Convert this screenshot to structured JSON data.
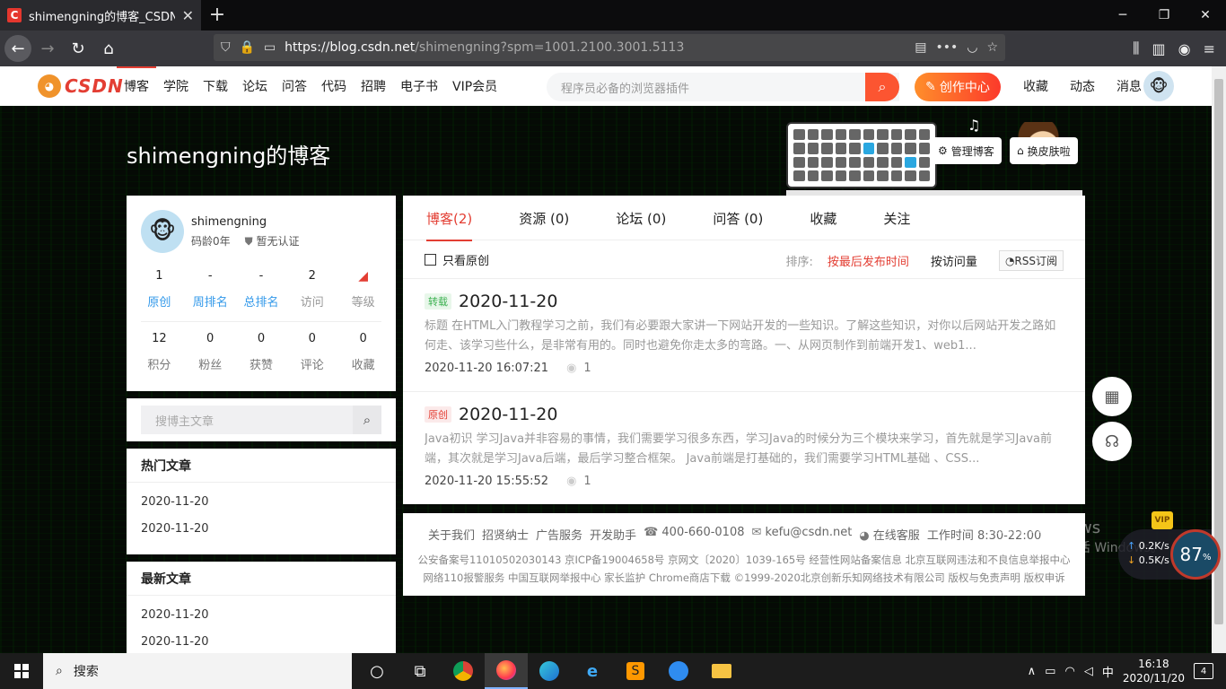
{
  "browser": {
    "tab_title": "shimengning的博客_CSDN博",
    "favicon": "C",
    "url_host": "https://blog.csdn.net",
    "url_path": "/shimengning?spm=1001.2100.3001.5113"
  },
  "header": {
    "logo_text": "CSDN",
    "nav": [
      "博客",
      "学院",
      "下载",
      "论坛",
      "问答",
      "代码",
      "招聘",
      "电子书",
      "VIP会员"
    ],
    "search_placeholder": "程序员必备的浏览器插件",
    "create_label": "创作中心",
    "links": [
      "收藏",
      "动态",
      "消息"
    ]
  },
  "banner": {
    "blog_title": "shimengning的博客",
    "manage_label": "管理博客",
    "skin_label": "换皮肤啦"
  },
  "profile": {
    "username": "shimengning",
    "age": "码龄0年",
    "cert": "暂无认证",
    "stats1": [
      {
        "num": "1",
        "label": "原创"
      },
      {
        "num": "-",
        "label": "周排名"
      },
      {
        "num": "-",
        "label": "总排名"
      },
      {
        "num": "2",
        "label": "访问"
      },
      {
        "num": "",
        "label": "等级"
      }
    ],
    "stats2": [
      {
        "num": "12",
        "label": "积分"
      },
      {
        "num": "0",
        "label": "粉丝"
      },
      {
        "num": "0",
        "label": "获赞"
      },
      {
        "num": "0",
        "label": "评论"
      },
      {
        "num": "0",
        "label": "收藏"
      }
    ]
  },
  "sidebar_search": {
    "placeholder": "搜博主文章"
  },
  "hot": {
    "title": "热门文章",
    "items": [
      "2020-11-20",
      "2020-11-20"
    ]
  },
  "latest": {
    "title": "最新文章",
    "items": [
      "2020-11-20",
      "2020-11-20"
    ]
  },
  "tabs": [
    "博客(2)",
    "资源 (0)",
    "论坛 (0)",
    "问答 (0)",
    "收藏",
    "关注"
  ],
  "filter": {
    "original_only": "只看原创",
    "sort_label": "排序:",
    "sort_options": [
      "按最后发布时间",
      "按访问量"
    ],
    "rss": "RSS订阅"
  },
  "articles": [
    {
      "tag": "转载",
      "title": "2020-11-20",
      "desc": "标题 在HTML入门教程学习之前，我们有必要跟大家讲一下网站开发的一些知识。了解这些知识，对你以后网站开发之路如何走、该学习些什么，是非常有用的。同时也避免你走太多的弯路。一、从网页制作到前端开发1、web1...",
      "time": "2020-11-20 16:07:21",
      "views": "1"
    },
    {
      "tag": "原创",
      "title": "2020-11-20",
      "desc": "Java初识 学习Java并非容易的事情，我们需要学习很多东西，学习Java的时候分为三个模块来学习，首先就是学习Java前端，其次就是学习Java后端，最后学习整合框架。 Java前端是打基础的，我们需要学习HTML基础 、CSS...",
      "time": "2020-11-20 15:55:52",
      "views": "1"
    }
  ],
  "footer": {
    "links": [
      "关于我们",
      "招贤纳士",
      "广告服务",
      "开发助手"
    ],
    "phone": "400-660-0108",
    "email": "kefu@csdn.net",
    "service": "在线客服",
    "hours": "工作时间 8:30-22:00",
    "line2": "公安备案号11010502030143  京ICP备19004658号  京网文〔2020〕1039-165号  经营性网站备案信息  北京互联网违法和不良信息举报中心",
    "line3": "网络110报警服务  中国互联网举报中心  家长监护  Chrome商店下载  ©1999-2020北京创新乐知网络技术有限公司  版权与免责声明  版权申诉"
  },
  "watermark": {
    "line1": "激活 Windows",
    "line2": "转到\"设置\"以激活 Windows。"
  },
  "netwidget": {
    "up": "0.2K/s",
    "down": "0.5K/s",
    "percent": "87",
    "unit": "%",
    "vip": "VIP"
  },
  "taskbar": {
    "search_label": "搜索",
    "ime": "中",
    "time": "16:18",
    "date": "2020/11/20",
    "notif_count": "4"
  },
  "colors": {
    "accent": "#e33e33",
    "create_from": "#ff8e2b",
    "create_to": "#fc3a2b",
    "link_blue": "#3399ea"
  }
}
